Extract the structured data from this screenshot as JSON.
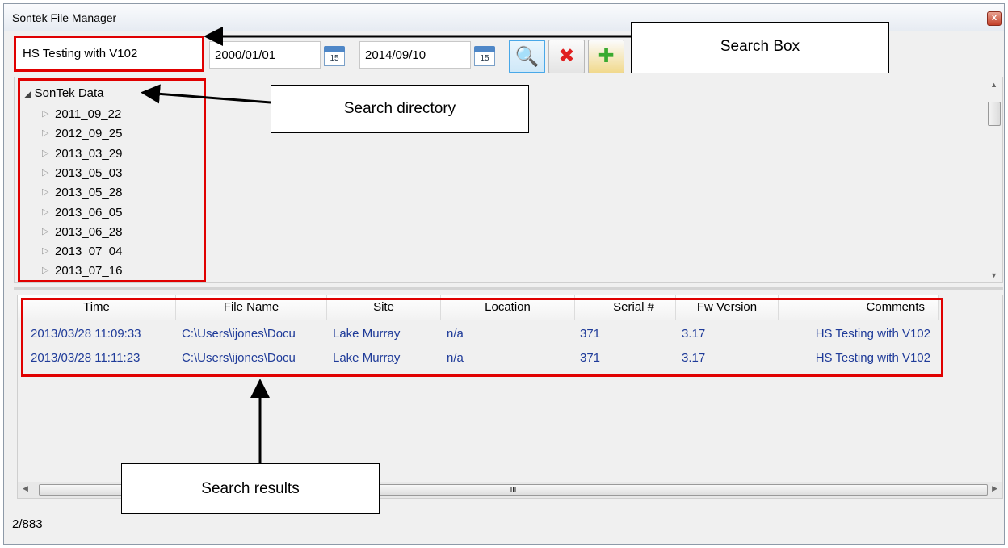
{
  "window": {
    "title": "Sontek File Manager",
    "close_glyph": "x"
  },
  "toolbar": {
    "search_value": "HS Testing with V102",
    "date_from": "2000/01/01",
    "date_to": "2014/09/10",
    "calendar_glyph": "15",
    "buttons": [
      {
        "icon": "search-folder-icon",
        "glyph": "🔍"
      },
      {
        "icon": "delete-icon",
        "glyph": "✖"
      },
      {
        "icon": "add-folder-icon",
        "glyph": "✚"
      }
    ]
  },
  "callouts": {
    "search_box": "Search Box",
    "search_directory": "Search directory",
    "search_results": "Search results"
  },
  "tree": {
    "root": "SonTek Data",
    "items": [
      "2011_09_22",
      "2012_09_25",
      "2013_03_29",
      "2013_05_03",
      "2013_05_28",
      "2013_06_05",
      "2013_06_28",
      "2013_07_04",
      "2013_07_16"
    ]
  },
  "results": {
    "columns": [
      "Time",
      "File Name",
      "Site",
      "Location",
      "Serial #",
      "Fw Version",
      "Comments"
    ],
    "rows": [
      [
        "2013/03/28 11:09:33",
        "C:\\Users\\ijones\\Docu",
        "Lake Murray",
        "n/a",
        "371",
        "3.17",
        "HS Testing with V102"
      ],
      [
        "2013/03/28 11:11:23",
        "C:\\Users\\ijones\\Docu",
        "Lake Murray",
        "n/a",
        "371",
        "3.17",
        "HS Testing with V102"
      ]
    ],
    "scroll_thumb_glyph": "III"
  },
  "status": {
    "count": "2/883"
  },
  "colors": {
    "highlight": "#e00000",
    "link_text": "#1f3b99",
    "calendar": "#4f87c7"
  }
}
